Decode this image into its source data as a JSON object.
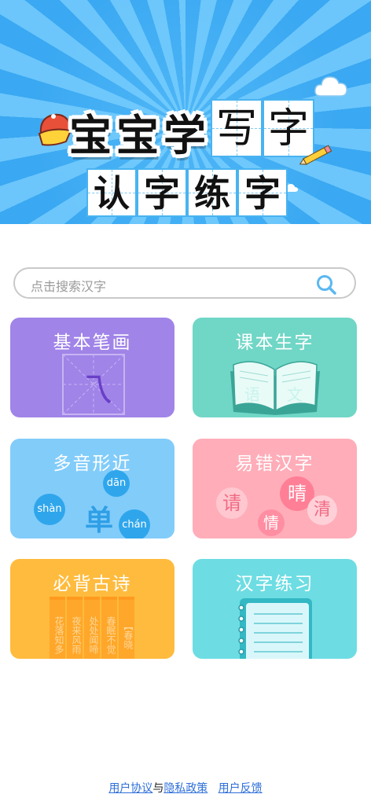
{
  "banner": {
    "title_part1": [
      "宝",
      "宝",
      "学"
    ],
    "title_part2": [
      "写",
      "字"
    ],
    "title_part3": [
      "认",
      "字",
      "练",
      "字"
    ]
  },
  "search": {
    "placeholder": "点击搜索汉字",
    "icon": "search-icon"
  },
  "cards": [
    {
      "title": "基本笔画",
      "color": "#a084e8",
      "icon": "stroke-grid-icon",
      "stroke": "乁"
    },
    {
      "title": "课本生字",
      "color": "#70d6c6",
      "icon": "textbook-icon",
      "book_left": "语",
      "book_right": "文"
    },
    {
      "title": "多音形近",
      "color": "#82ccfa",
      "icon": "pinyin-icon",
      "pinyin": [
        "dān",
        "shàn",
        "chán"
      ],
      "char": "单"
    },
    {
      "title": "易错汉字",
      "color": "#ffadb9",
      "icon": "confusable-chars-icon",
      "chars": [
        "请",
        "晴",
        "情",
        "清"
      ]
    },
    {
      "title": "必背古诗",
      "color": "#ffbb3d",
      "icon": "scroll-icon",
      "columns": [
        "花落知多",
        "夜来风雨",
        "处处闻啼",
        "春眠不觉",
        "【春晓"
      ]
    },
    {
      "title": "汉字练习",
      "color": "#6ddde3",
      "icon": "notebook-icon"
    }
  ],
  "footer": {
    "agreement": "用户协议",
    "and": "与",
    "privacy": "隐私政策",
    "feedback": "用户反馈"
  }
}
